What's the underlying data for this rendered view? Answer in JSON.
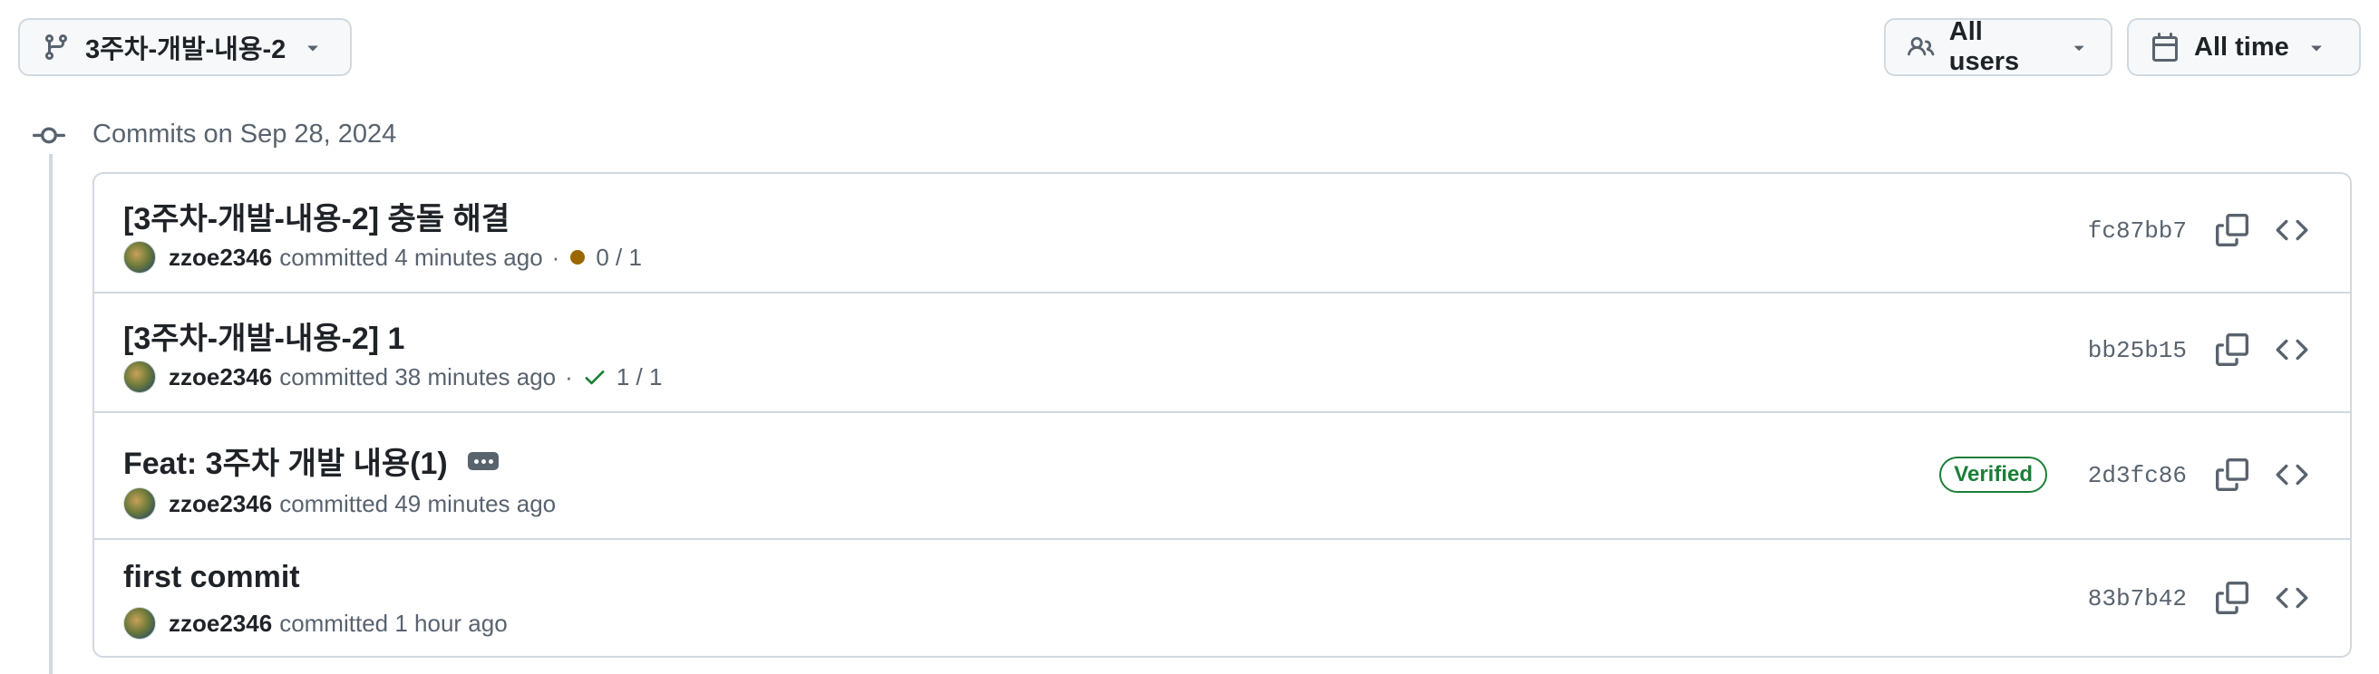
{
  "toolbar": {
    "branch": "3주차-개발-내용-2",
    "users": "All users",
    "time": "All time"
  },
  "group": {
    "title": "Commits on Sep 28, 2024"
  },
  "commits": [
    {
      "title": "[3주차-개발-내용-2] 충돌 해결",
      "author": "zzoe2346",
      "action": "committed",
      "time": "4 minutes ago",
      "sep": "·",
      "checks": "0 / 1",
      "check_state": "pending",
      "sha": "fc87bb7"
    },
    {
      "title": "[3주차-개발-내용-2] 1",
      "author": "zzoe2346",
      "action": "committed",
      "time": "38 minutes ago",
      "sep": "·",
      "checks": "1 / 1",
      "check_state": "success",
      "sha": "bb25b15"
    },
    {
      "title": "Feat: 3주차 개발 내용(1)",
      "author": "zzoe2346",
      "action": "committed",
      "time": "49 minutes ago",
      "badge": "Verified",
      "sha": "2d3fc86"
    },
    {
      "title": "first commit",
      "author": "zzoe2346",
      "action": "committed",
      "time": "1 hour ago",
      "sha": "83b7b42"
    }
  ],
  "colors": {
    "pending": "#9a6700",
    "success": "#1a7f37",
    "border": "#d1d9e0",
    "muted": "#59636e"
  }
}
